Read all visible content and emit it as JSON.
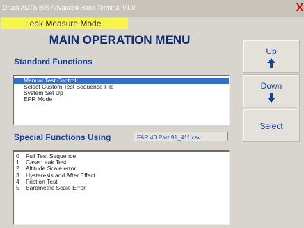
{
  "window": {
    "title": "Druck ADTS 505 Advanced Hand Terminal V1.0",
    "close_label": "X"
  },
  "mode": {
    "label": "Leak Measure Mode"
  },
  "main": {
    "title": "MAIN OPERATION MENU"
  },
  "standard": {
    "heading": "Standard Functions",
    "items": [
      {
        "label": "Manual Test Control",
        "selected": true
      },
      {
        "label": "Select Custom Test Sequence File",
        "selected": false
      },
      {
        "label": "System Set Up",
        "selected": false
      },
      {
        "label": "EPR Mode",
        "selected": false
      }
    ]
  },
  "special": {
    "heading": "Special Functions Using",
    "file": "FAR 43 Part 91_411.csv",
    "items": [
      {
        "num": "0",
        "label": "Full Test Sequence"
      },
      {
        "num": "1",
        "label": "Case Leak Test"
      },
      {
        "num": "2",
        "label": "Altitude Scale error"
      },
      {
        "num": "3",
        "label": "Hysteresis and After Effect"
      },
      {
        "num": "4",
        "label": "Friction Test"
      },
      {
        "num": "5",
        "label": "Barometric Scale Error"
      }
    ]
  },
  "buttons": {
    "up": "Up",
    "down": "Down",
    "select": "Select"
  },
  "icons": {
    "up": "arrow-up-icon",
    "down": "arrow-down-icon",
    "close": "close-icon"
  }
}
